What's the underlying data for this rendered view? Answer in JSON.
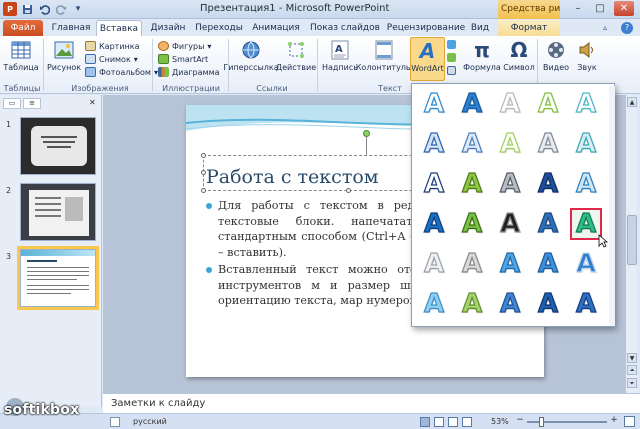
{
  "window": {
    "title": "Презентация1 - Microsoft PowerPoint",
    "tool_tab_header": "Средства рисования",
    "app_icon": "P",
    "qat": [
      "save-icon",
      "undo-icon",
      "redo-icon",
      "dropdown-icon"
    ]
  },
  "tabs": [
    "Файл",
    "Главная",
    "Вставка",
    "Дизайн",
    "Переходы",
    "Анимация",
    "Показ слайдов",
    "Рецензирование",
    "Вид",
    "Формат"
  ],
  "ribbon": {
    "tables": {
      "label": "Таблица",
      "group": "Таблицы"
    },
    "images": {
      "picture": "Рисунок",
      "clipart": "Картинка",
      "snapshot": "Снимок",
      "album": "Фотоальбом",
      "group": "Изображения"
    },
    "illustrations": {
      "shapes": "Фигуры",
      "smartart": "SmartArt",
      "chart": "Диаграмма",
      "group": "Иллюстрации"
    },
    "links": {
      "hyperlink": "Гиперссылка",
      "action": "Действие",
      "group": "Ссылки"
    },
    "text": {
      "textbox": "Надпись",
      "headerfooter": "Колонтитулы",
      "wordart": "WordArt",
      "group": "Текст"
    },
    "symbols": {
      "formula": "Формула",
      "symbol": "Символ"
    },
    "media": {
      "video": "Видео",
      "audio": "Звук"
    }
  },
  "slides_panel": {
    "numbers": [
      "1",
      "2",
      "3"
    ]
  },
  "slide": {
    "title": "Работа с текстом",
    "bullets": [
      "Для работы с текстом в редактор специальные текстовые блоки. напечатать или скопирова стандартным способом (Ctrl+A – копировать, Ctrl+V – вставить).",
      "Вставленный текст можно отф этого на панели инструментов м и размер шрифта, между стро ориентацию текста, мар нумерованный списки."
    ]
  },
  "notes": {
    "placeholder": "Заметки к слайду"
  },
  "status": {
    "language": "русский",
    "zoom": "53%"
  },
  "watermark": "softikbox",
  "wordart_gallery": {
    "glyph": "A",
    "selected_index": 19,
    "styles": [
      {
        "fill": "#ffffff",
        "stroke": "#2a8bd4"
      },
      {
        "fill": "#2b7fd0",
        "stroke": "#1a5a9a"
      },
      {
        "fill": "#ffffff",
        "stroke": "#b9b9b9"
      },
      {
        "fill": "#ffffff",
        "stroke": "#7fc03c"
      },
      {
        "fill": "#ffffff",
        "stroke": "#49b8c8"
      },
      {
        "fill": "#d6e4f5",
        "stroke": "#2a66b4"
      },
      {
        "fill": "#dfe9f7",
        "stroke": "#4a7fc0"
      },
      {
        "fill": "#ffffff",
        "stroke": "#9ed25a"
      },
      {
        "fill": "#e9ecef",
        "stroke": "#7f8a96"
      },
      {
        "fill": "#d9eef2",
        "stroke": "#3aa7b8"
      },
      {
        "fill": "#ffffff",
        "stroke": "#1d3e7a"
      },
      {
        "fill": "#8ec63f",
        "stroke": "#4d7a1e"
      },
      {
        "fill": "#b8bec6",
        "stroke": "#555c66"
      },
      {
        "fill": "#1e4f9b",
        "stroke": "#0e2d63"
      },
      {
        "fill": "#cfe7f7",
        "stroke": "#2b7fbf"
      },
      {
        "fill": "#1a6fc4",
        "stroke": "#0d3f7a"
      },
      {
        "fill": "#7ac143",
        "stroke": "#3b6e1a"
      },
      {
        "fill": "#222222",
        "stroke": "#999999"
      },
      {
        "fill": "#2f6fb8",
        "stroke": "#1a4a80"
      },
      {
        "fill": "#2dbd84",
        "stroke": "#137a52"
      },
      {
        "fill": "#f2f2f2",
        "stroke": "#9aa3ad"
      },
      {
        "fill": "#d9d9d9",
        "stroke": "#8a8a8a"
      },
      {
        "fill": "#4fa3e0",
        "stroke": "#2068a8"
      },
      {
        "fill": "#3d8fd8",
        "stroke": "#1f5a9c"
      },
      {
        "fill": "#2f7fd0",
        "stroke": "#c9d9ef"
      },
      {
        "fill": "#8fd0f2",
        "stroke": "#3f8fc8"
      },
      {
        "fill": "#a4d46b",
        "stroke": "#5e8f2e"
      },
      {
        "fill": "#3f86d6",
        "stroke": "#1f4f8f"
      },
      {
        "fill": "#1f5faf",
        "stroke": "#0c3570"
      },
      {
        "fill": "#2d6fc0",
        "stroke": "#123f80"
      }
    ]
  }
}
